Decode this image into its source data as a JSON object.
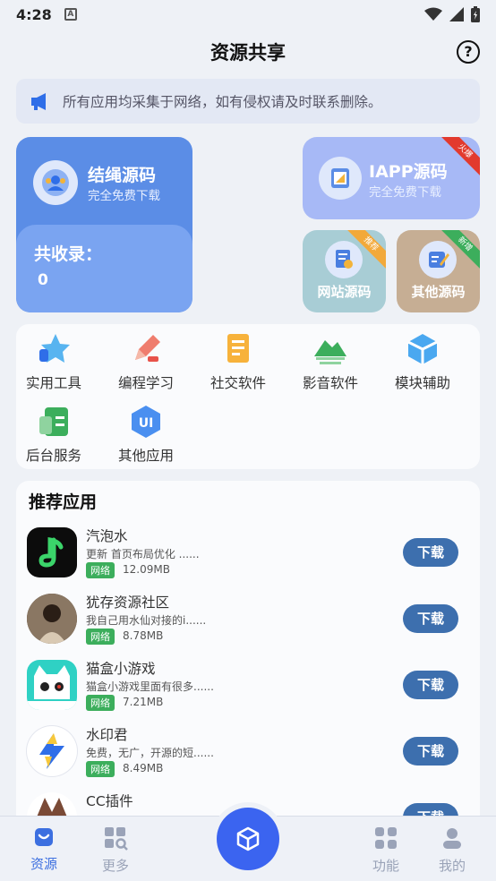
{
  "status": {
    "time": "4:28"
  },
  "header": {
    "title": "资源共享"
  },
  "notice": {
    "text": "所有应用均采集于网络，如有侵权请及时联系删除。"
  },
  "card_main": {
    "title": "结绳源码",
    "subtitle": "完全免费下载",
    "count_label": "共收录：",
    "count_value": "0"
  },
  "card_iapp": {
    "title": "IAPP源码",
    "subtitle": "完全免费下载",
    "ribbon": "火爆"
  },
  "card_web": {
    "title": "网站源码",
    "ribbon": "推荐"
  },
  "card_other": {
    "title": "其他源码",
    "ribbon": "新增"
  },
  "categories": [
    "实用工具",
    "编程学习",
    "社交软件",
    "影音软件",
    "模块辅助",
    "后台服务",
    "其他应用"
  ],
  "recommend": {
    "title": "推荐应用",
    "download_label": "下载",
    "apps": [
      {
        "name": "汽泡水",
        "desc": "更新 首页布局优化 ......",
        "tag": "网络",
        "size": "12.09MB"
      },
      {
        "name": "犹存资源社区",
        "desc": "我自己用水仙对接的i......",
        "tag": "网络",
        "size": "8.78MB"
      },
      {
        "name": "猫盒小游戏",
        "desc": "猫盒小游戏里面有很多......",
        "tag": "网络",
        "size": "7.21MB"
      },
      {
        "name": "水印君",
        "desc": "免费，无广，开源的短......",
        "tag": "网络",
        "size": "8.49MB"
      },
      {
        "name": "CC插件",
        "desc": "",
        "tag": "",
        "size": ""
      }
    ]
  },
  "tabs": {
    "home": "资源",
    "more": "更多",
    "features": "功能",
    "mine": "我的"
  }
}
